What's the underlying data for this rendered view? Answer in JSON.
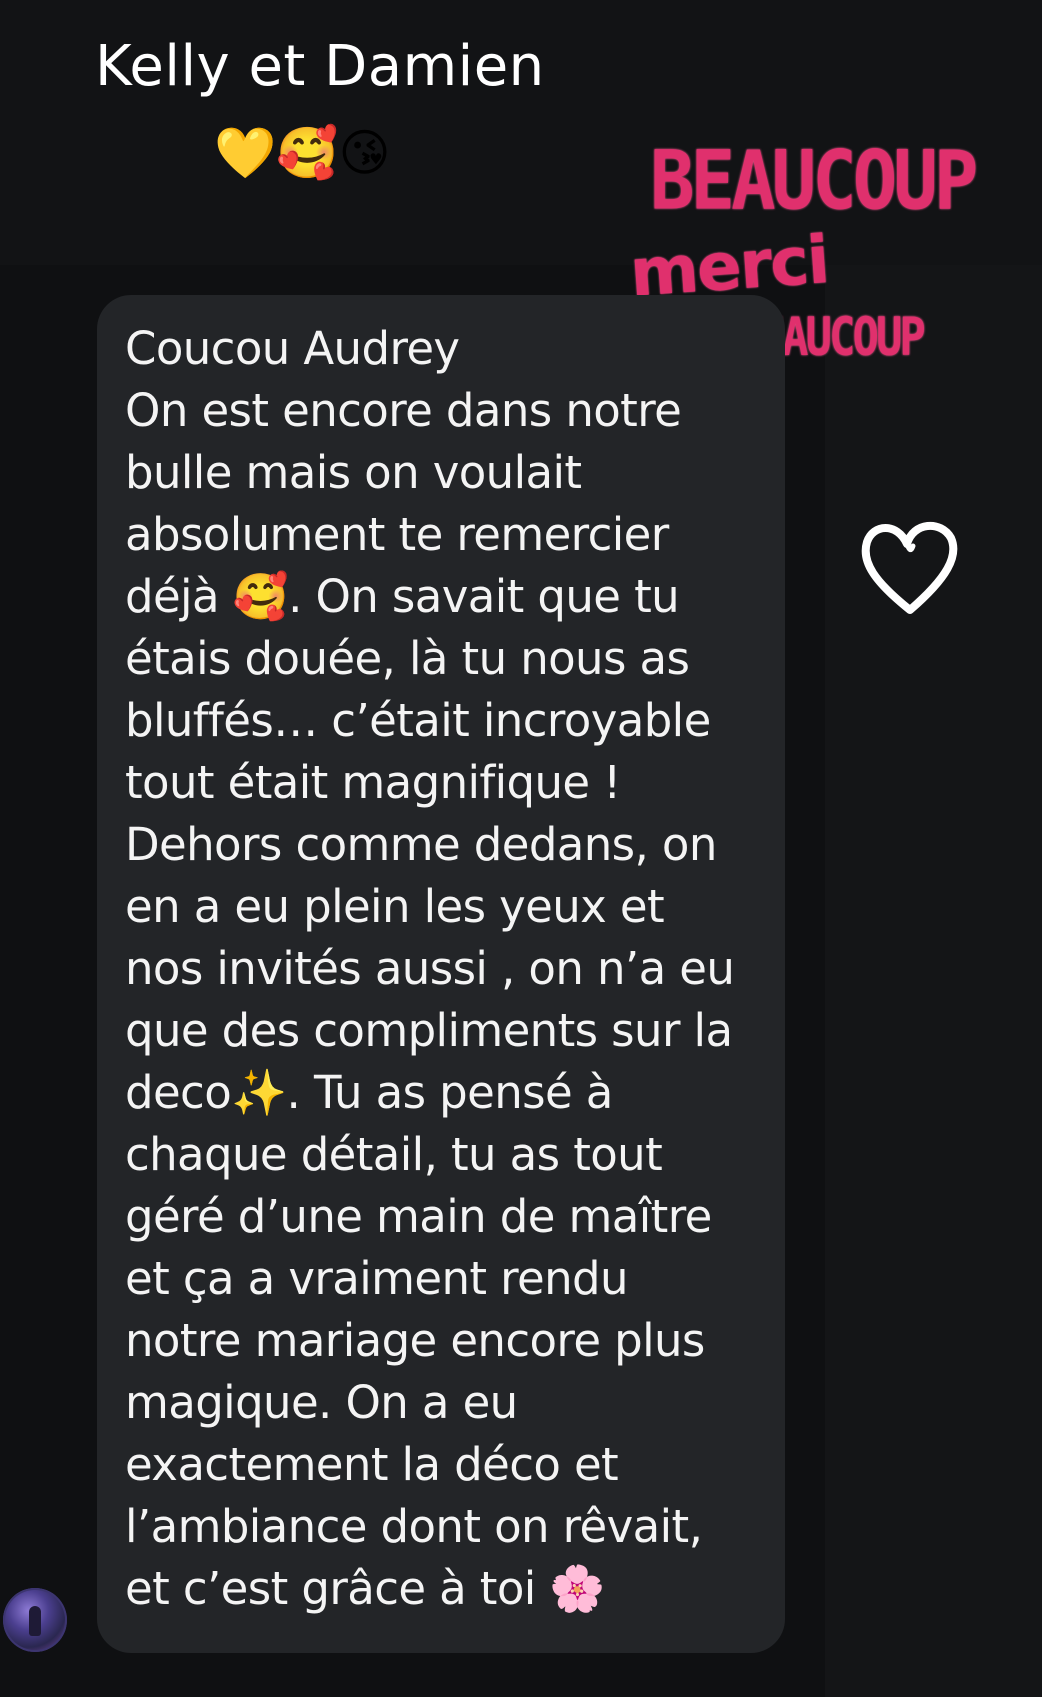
{
  "story": {
    "caption": {
      "title": "Kelly et Damien",
      "emojis": [
        "💛",
        "🥰",
        "😘"
      ]
    },
    "stickers": {
      "beaucoup_top": "BEAUCOUP",
      "merci": "merci",
      "beaucoup_bottom": "BEAUCOUP",
      "heart_icon": "heart-outline-icon"
    }
  },
  "message": {
    "text": "Coucou Audrey\nOn est encore dans notre\nbulle mais on voulait\nabsolument te remercier\ndéjà 🥰. On savait que tu\nétais douée, là tu nous as\nbluffés… c’était incroyable\ntout était magnifique !\nDehors comme dedans, on\nen a eu plein les yeux et\nnos invités aussi , on n’a eu\nque des compliments sur la\ndeco✨. Tu as pensé à\nchaque détail, tu as tout\ngéré d’une main de maître\net ça a vraiment rendu\nnotre mariage encore plus\nmagique. On a eu\nexactement la déco et\nl’ambiance dont on rêvait,\net c’est grâce à toi 🌸",
    "sender_avatar_icon": "avatar-icon"
  },
  "colors": {
    "background": "#131416",
    "bubble": "#232528",
    "text": "#f4f4f4",
    "sticker_pink": "#e0306d"
  }
}
